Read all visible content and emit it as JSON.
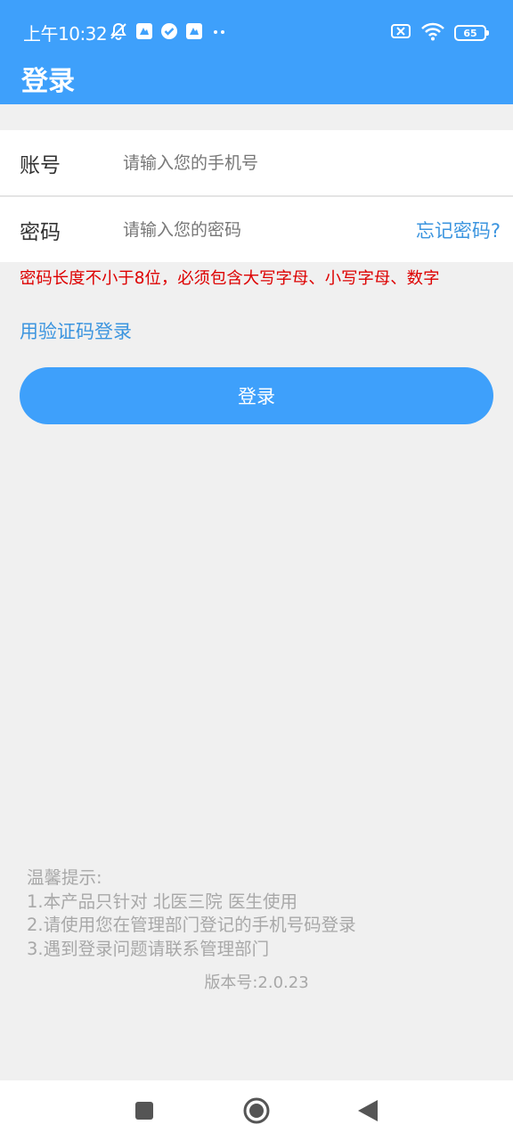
{
  "status_bar": {
    "time": "上午10:32",
    "left_icons": [
      "mute-icon",
      "app-notification-icon",
      "check-icon",
      "app-notification-icon",
      "more-dots-icon"
    ],
    "right_icons": [
      "sim-off-icon",
      "wifi-icon"
    ],
    "battery_level": "65"
  },
  "app_bar": {
    "title": "登录"
  },
  "form": {
    "account_label": "账号",
    "account_placeholder": "请输入您的手机号",
    "password_label": "密码",
    "password_placeholder": "请输入您的密码",
    "forgot_label": "忘记密码?"
  },
  "password_rule": "密码长度不小于8位，必须包含大写字母、小写字母、数字",
  "sms_login_label": "用验证码登录",
  "login_button_label": "登录",
  "tips": {
    "title": "温馨提示:",
    "lines": [
      "1.本产品只针对 北医三院 医生使用",
      "2.请使用您在管理部门登记的手机号码登录",
      "3.遇到登录问题请联系管理部门"
    ]
  },
  "version_label": "版本号:",
  "version_value": "2.0.23",
  "colors": {
    "primary": "#3ea0fb",
    "link": "#3c95df",
    "warning": "#dd0000",
    "background": "#f0f0f0"
  },
  "nav_bar": [
    "recents-icon",
    "home-icon",
    "back-icon"
  ]
}
